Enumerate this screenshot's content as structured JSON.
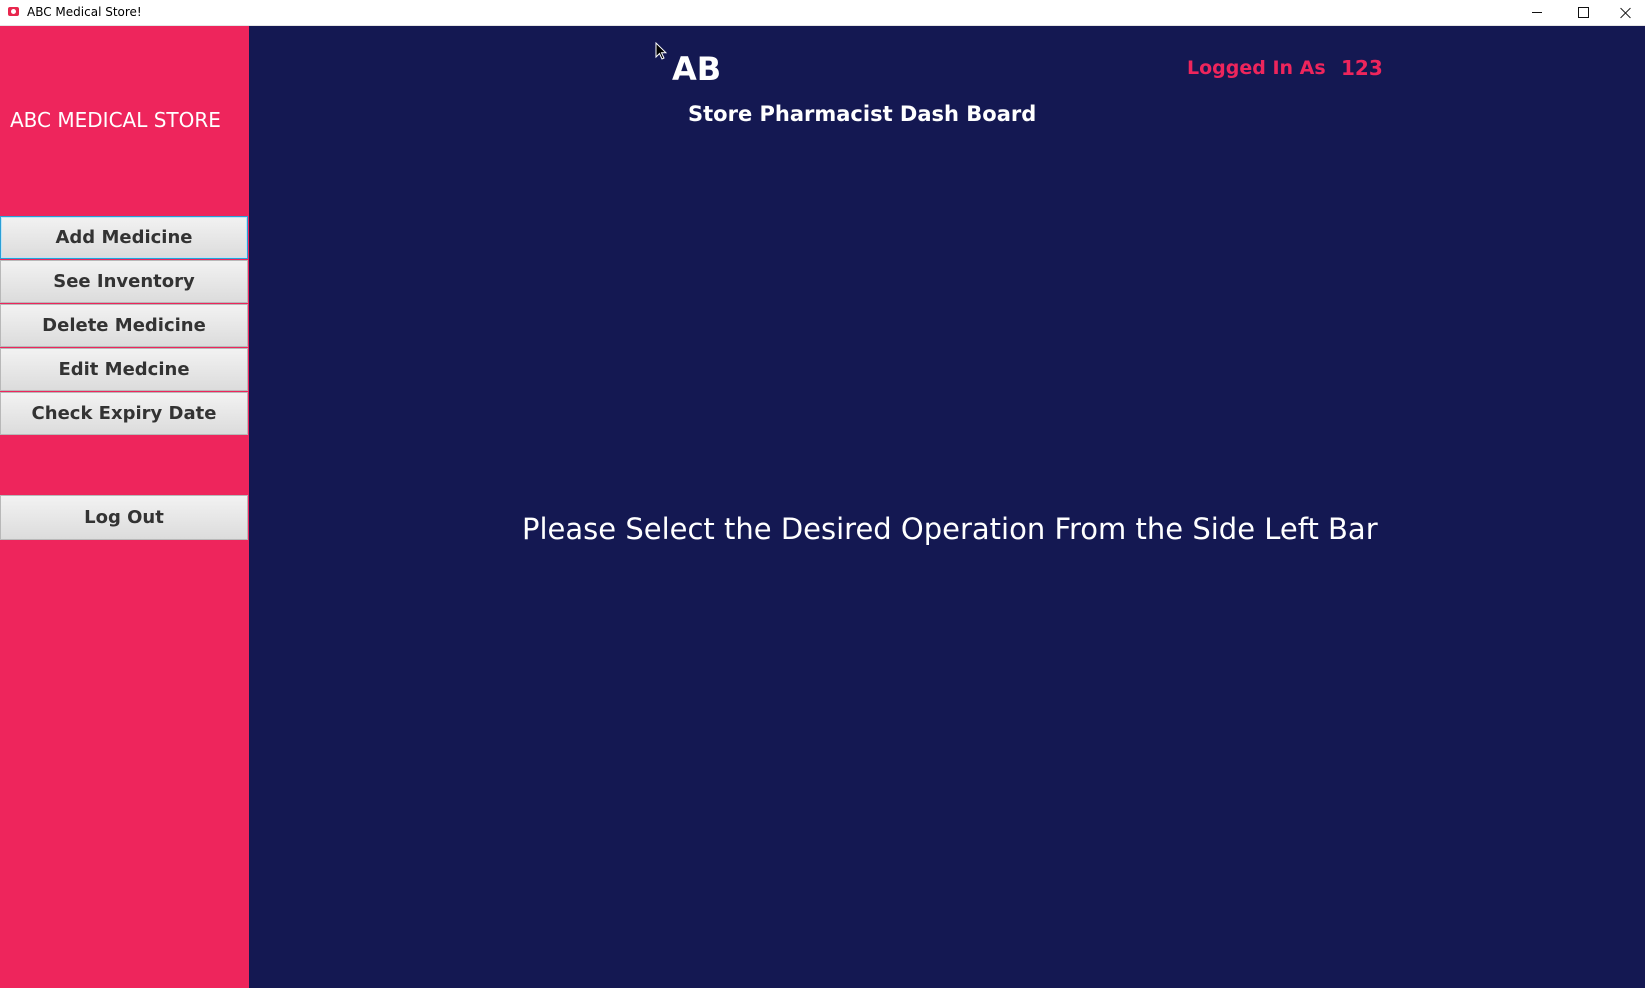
{
  "window": {
    "title": "ABC Medical Store!",
    "controls": {
      "minimize": "minimize",
      "maximize": "maximize",
      "close": "close"
    }
  },
  "sidebar": {
    "brand": "ABC MEDICAL STORE",
    "buttons": [
      {
        "label": "Add Medicine"
      },
      {
        "label": "See Inventory"
      },
      {
        "label": "Delete Medicine"
      },
      {
        "label": "Edit Medcine"
      },
      {
        "label": "Check Expiry Date"
      }
    ],
    "logout_label": "Log Out"
  },
  "header": {
    "initials": "AB",
    "subtitle": "Store Pharmacist Dash Board",
    "logged_in_label": "Logged In As",
    "logged_in_user": "123"
  },
  "main": {
    "message": "Please Select the Desired Operation From the Side Left Bar"
  },
  "colors": {
    "sidebar": "#ee255c",
    "main_background": "#141852",
    "accent_text": "#ee255c",
    "button_text": "#333333"
  },
  "icons": {
    "app": "app-icon",
    "minimize": "minimize-icon",
    "maximize": "maximize-icon",
    "close": "close-icon",
    "cursor": "mouse-cursor-icon"
  }
}
